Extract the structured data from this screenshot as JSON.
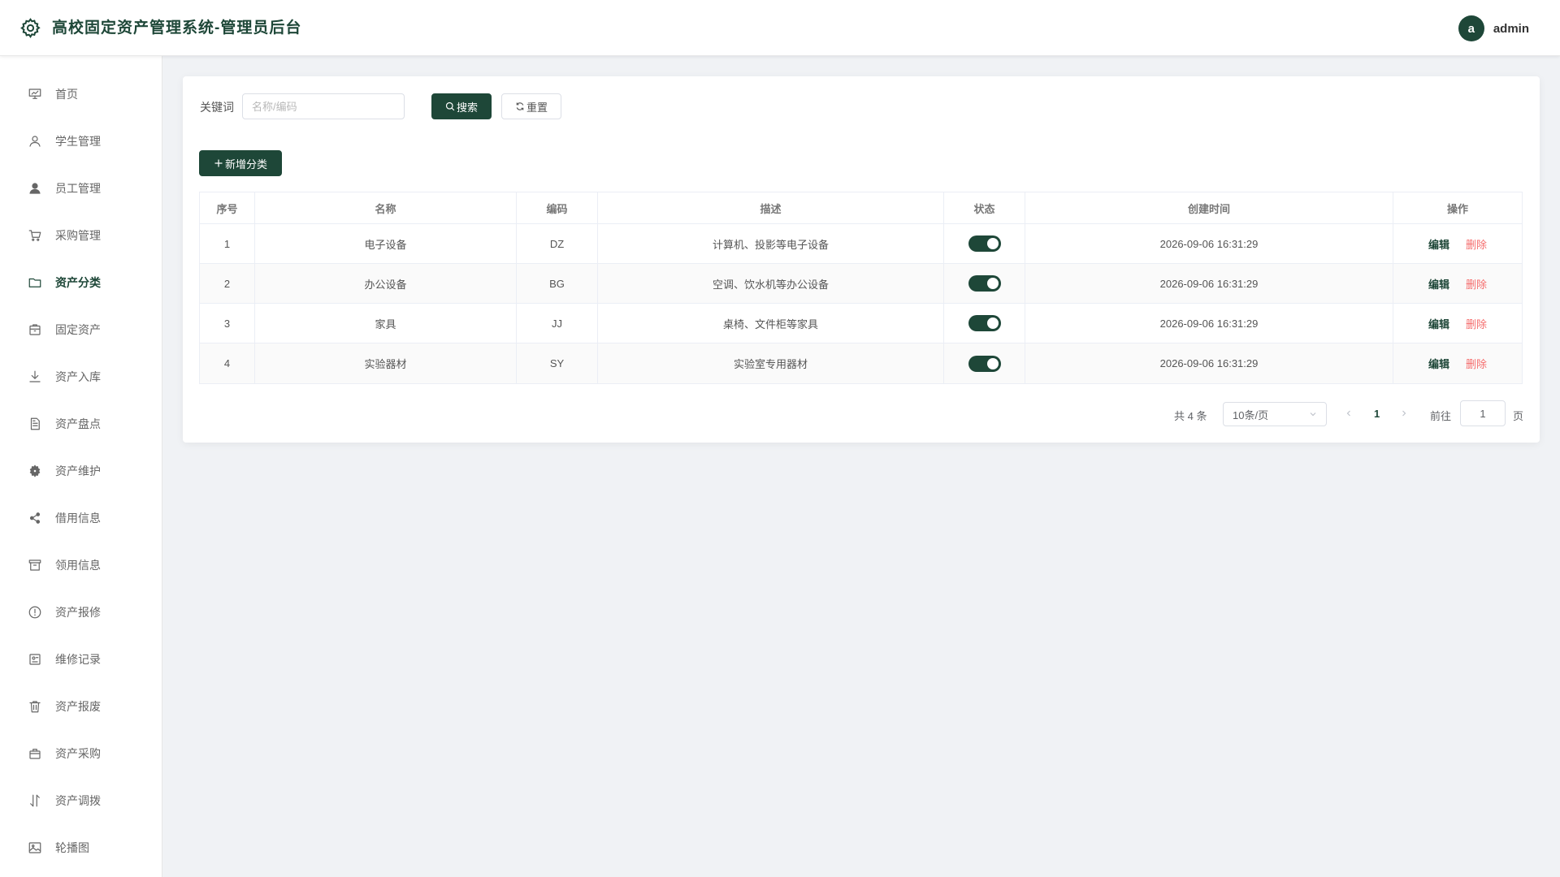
{
  "header": {
    "title": "高校固定资产管理系统-管理员后台",
    "avatar_letter": "a",
    "username": "admin",
    "logo_icon": "gear-icon"
  },
  "theme": {
    "accent": "#1e4738",
    "danger": "#f56c6c"
  },
  "sidebar": {
    "items": [
      {
        "label": "首页",
        "icon": "dashboard-icon"
      },
      {
        "label": "学生管理",
        "icon": "user-icon"
      },
      {
        "label": "员工管理",
        "icon": "user-filled-icon"
      },
      {
        "label": "采购管理",
        "icon": "cart-icon"
      },
      {
        "label": "资产分类",
        "icon": "folder-icon",
        "active": true
      },
      {
        "label": "固定资产",
        "icon": "box-icon"
      },
      {
        "label": "资产入库",
        "icon": "download-icon"
      },
      {
        "label": "资产盘点",
        "icon": "document-icon"
      },
      {
        "label": "资产维护",
        "icon": "settings-icon"
      },
      {
        "label": "借用信息",
        "icon": "share-icon"
      },
      {
        "label": "领用信息",
        "icon": "archive-icon"
      },
      {
        "label": "资产报修",
        "icon": "warning-icon"
      },
      {
        "label": "维修记录",
        "icon": "record-icon"
      },
      {
        "label": "资产报废",
        "icon": "trash-icon"
      },
      {
        "label": "资产采购",
        "icon": "bag-icon"
      },
      {
        "label": "资产调拨",
        "icon": "transfer-icon"
      },
      {
        "label": "轮播图",
        "icon": "picture-icon"
      }
    ]
  },
  "search": {
    "label": "关键词",
    "placeholder": "名称/编码",
    "value": "",
    "search_button": "搜索",
    "reset_button": "重置"
  },
  "toolbar": {
    "add_button": "新增分类"
  },
  "table": {
    "columns": [
      "序号",
      "名称",
      "编码",
      "描述",
      "状态",
      "创建时间",
      "操作"
    ],
    "rows": [
      {
        "index": "1",
        "name": "电子设备",
        "code": "DZ",
        "desc": "计算机、投影等电子设备",
        "status": true,
        "created": "2026-09-06 16:31:29"
      },
      {
        "index": "2",
        "name": "办公设备",
        "code": "BG",
        "desc": "空调、饮水机等办公设备",
        "status": true,
        "created": "2026-09-06 16:31:29"
      },
      {
        "index": "3",
        "name": "家具",
        "code": "JJ",
        "desc": "桌椅、文件柜等家具",
        "status": true,
        "created": "2026-09-06 16:31:29"
      },
      {
        "index": "4",
        "name": "实验器材",
        "code": "SY",
        "desc": "实验室专用器材",
        "status": true,
        "created": "2026-09-06 16:31:29"
      }
    ],
    "edit_label": "编辑",
    "delete_label": "删除"
  },
  "pagination": {
    "total_text": "共 4 条",
    "page_size": "10条/页",
    "current_page": "1",
    "goto_label": "前往",
    "goto_value": "1",
    "page_suffix": "页"
  }
}
